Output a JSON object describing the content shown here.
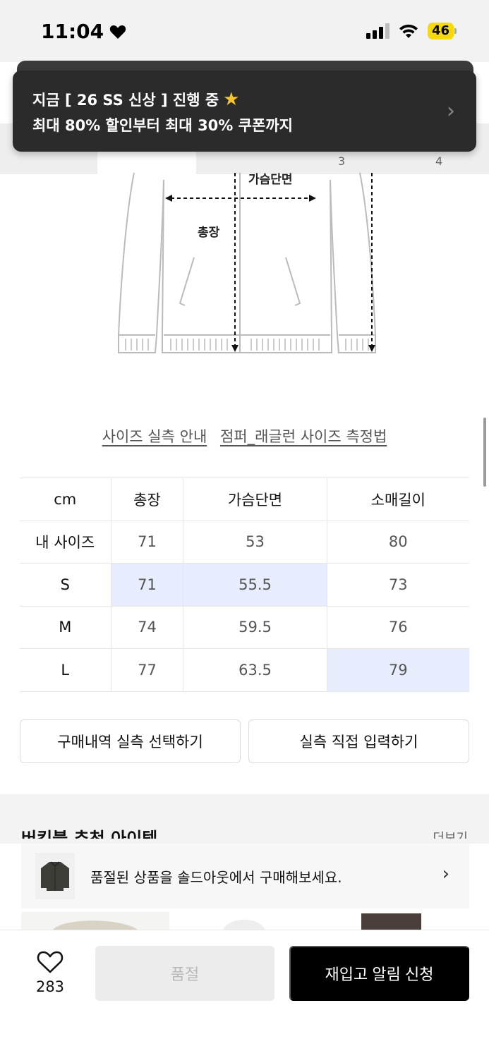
{
  "status_bar": {
    "time": "11:04",
    "battery": "46"
  },
  "tabs": {
    "num3": "3",
    "num4": "4"
  },
  "toast": {
    "line1": "지금 [ 26 SS 신상 ] 진행 중",
    "line2": "최대 80% 할인부터 최대 30% 쿠폰까지"
  },
  "diagram": {
    "label_chest": "가슴단면",
    "label_length": "총장"
  },
  "guide": {
    "link1": "사이즈 실측 안내",
    "link2": "점퍼_래글런 사이즈 측정법"
  },
  "size_table": {
    "headers": [
      "cm",
      "총장",
      "가슴단면",
      "소매길이"
    ],
    "rows": [
      {
        "label": "내 사이즈",
        "values": [
          "71",
          "53",
          "80"
        ]
      },
      {
        "label": "S",
        "values": [
          "71",
          "55.5",
          "73"
        ]
      },
      {
        "label": "M",
        "values": [
          "74",
          "59.5",
          "76"
        ]
      },
      {
        "label": "L",
        "values": [
          "77",
          "63.5",
          "79"
        ]
      }
    ]
  },
  "buttons": {
    "purchase_history": "구매내역 실측 선택하기",
    "manual_input": "실측 직접 입력하기"
  },
  "section": {
    "title_peek": "버킷블 추천 아이템",
    "more_peek": "더보기"
  },
  "soldout_banner": {
    "text": "품절된 상품을 솔드아웃에서 구매해보세요."
  },
  "bottom": {
    "like_count": "283",
    "soldout_label": "품절",
    "restock_label": "재입고 알림 신청"
  }
}
